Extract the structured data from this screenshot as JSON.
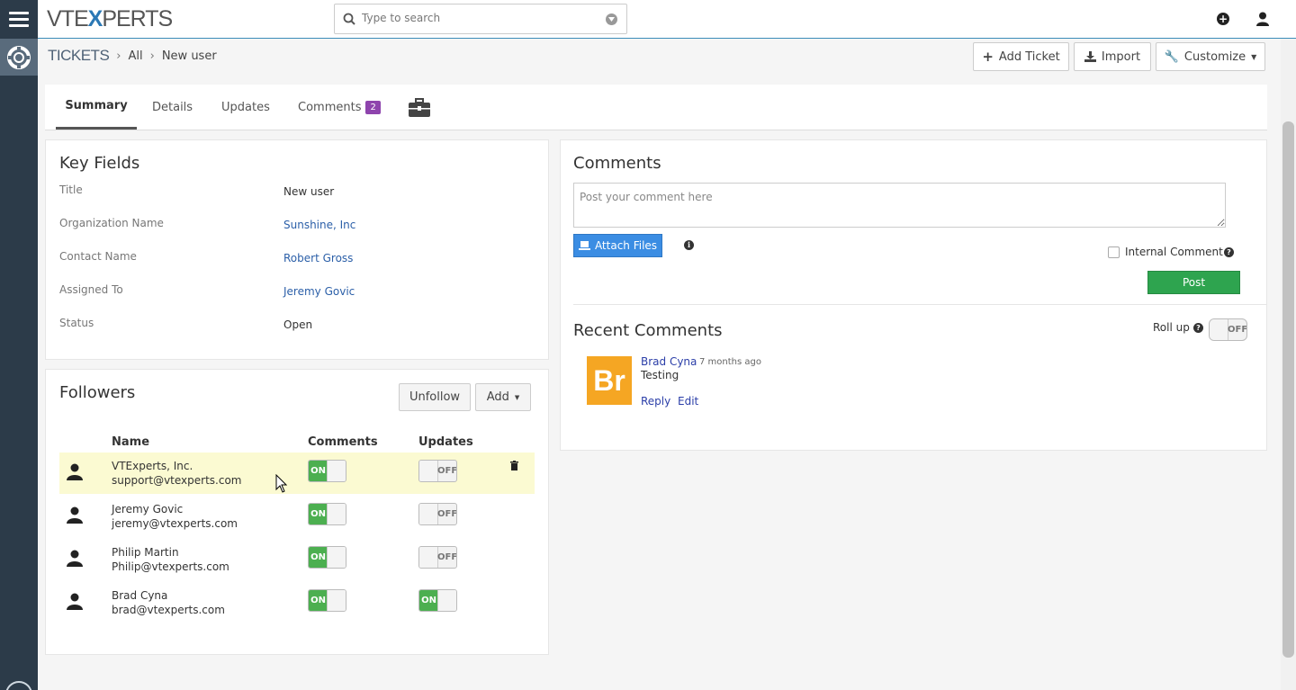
{
  "app": {
    "logo_prefix": "VTE",
    "logo_x": "X",
    "logo_suffix": "PERTS"
  },
  "search": {
    "placeholder": "Type to search"
  },
  "breadcrumb": {
    "module": "TICKETS",
    "level1": "All",
    "level2": "New user"
  },
  "actions": {
    "add_ticket": "Add Ticket",
    "import": "Import",
    "customize": "Customize"
  },
  "tabs": {
    "summary": "Summary",
    "details": "Details",
    "updates": "Updates",
    "comments": "Comments",
    "comments_count": "2"
  },
  "key_fields": {
    "title": "Key Fields",
    "rows": [
      {
        "label": "Title",
        "value": "New user"
      },
      {
        "label": "Organization Name",
        "value": "Sunshine, Inc"
      },
      {
        "label": "Contact Name",
        "value": "Robert Gross"
      },
      {
        "label": "Assigned To",
        "value": "Jeremy Govic"
      },
      {
        "label": "Status",
        "value": "Open"
      }
    ]
  },
  "followers": {
    "title": "Followers",
    "unfollow": "Unfollow",
    "add": "Add",
    "col_name": "Name",
    "col_comments": "Comments",
    "col_updates": "Updates",
    "rows": [
      {
        "name": "VTExperts, Inc.",
        "email": "support@vtexperts.com",
        "comments": "ON",
        "updates": "OFF"
      },
      {
        "name": "Jeremy Govic",
        "email": "jeremy@vtexperts.com",
        "comments": "ON",
        "updates": "OFF"
      },
      {
        "name": "Philip Martin",
        "email": "Philip@vtexperts.com",
        "comments": "ON",
        "updates": "OFF"
      },
      {
        "name": "Brad Cyna",
        "email": "brad@vtexperts.com",
        "comments": "ON",
        "updates": "ON"
      }
    ]
  },
  "comments": {
    "title": "Comments",
    "placeholder": "Post your comment here",
    "attach_files": "Attach Files",
    "internal_comment": "Internal Comment",
    "post": "Post",
    "recent_title": "Recent Comments",
    "roll_up": "Roll up",
    "roll_up_state": "OFF",
    "recent": [
      {
        "avatar": "Br",
        "author": "Brad Cyna",
        "time": "7 months ago",
        "text": "Testing",
        "reply": "Reply",
        "edit": "Edit"
      }
    ]
  },
  "colors": {
    "accent": "#2b78b5",
    "on": "#4caf50",
    "post": "#2ea44f",
    "attach": "#3b8de3",
    "badge": "#8e44ad",
    "avatar": "#f5a623",
    "sidebar": "#2c3b49"
  }
}
